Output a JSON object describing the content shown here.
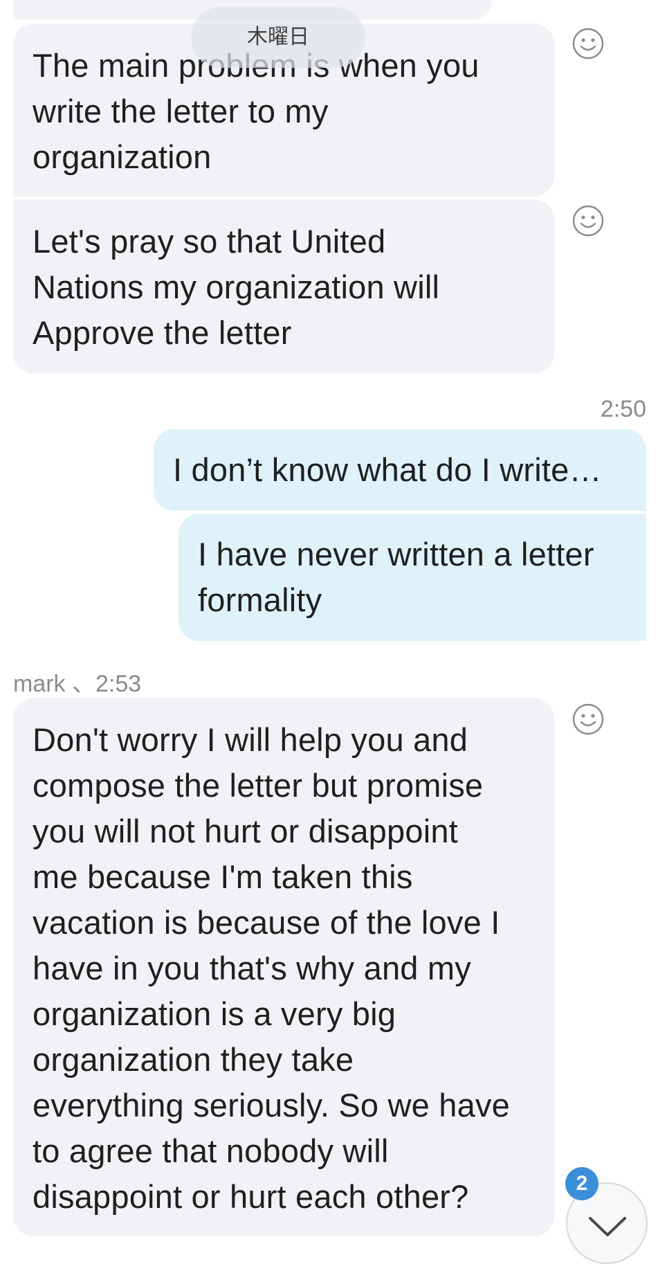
{
  "date_label": "木曜日",
  "messages": [
    {
      "direction": "incoming",
      "lines": [
        "The main problem is when you",
        "write the letter to my",
        "organization"
      ]
    },
    {
      "direction": "incoming",
      "lines": [
        "Let's pray so that United",
        "Nations my organization will",
        "Approve the letter"
      ]
    },
    {
      "direction": "outgoing",
      "time": "2:50",
      "lines": [
        "I don’t know what do I write…"
      ]
    },
    {
      "direction": "outgoing",
      "lines": [
        "I have never written a letter",
        "formality"
      ]
    },
    {
      "direction": "incoming",
      "sender_meta": "mark 、2:53",
      "lines": [
        "Don't worry I will help you and",
        "compose the letter but promise",
        "you will not hurt or disappoint",
        "me because I'm taken this",
        "vacation is because of the love I",
        "have in you that's why and my",
        "organization is a very big",
        "organization they take",
        "everything seriously. So we have",
        "to agree that nobody will",
        "disappoint or hurt each other?"
      ]
    }
  ],
  "scroll_button": {
    "badge": "2",
    "icon": "chevron-down-icon"
  },
  "icons": {
    "reaction": "smiley-icon"
  },
  "colors": {
    "incoming_bubble": "#f0f2f5",
    "outgoing_bubble": "#dff1f9",
    "badge": "#3b8fd9",
    "timestamp": "#8a8a8a"
  }
}
